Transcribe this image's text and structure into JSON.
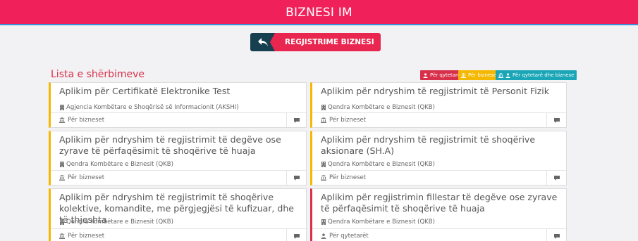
{
  "header": {
    "title": "BIZNESI IM"
  },
  "toolbar": {
    "register_label": "REGJISTRIME BIZNESI"
  },
  "list": {
    "title": "Lista e shërbimeve"
  },
  "legend": [
    {
      "label": "Për qytetarë"
    },
    {
      "label": "Për biznese"
    },
    {
      "label": "Për qytetarë dhe biznese"
    }
  ],
  "colors": {
    "header": "#f0215a",
    "business": "#f5b800",
    "citizen": "#d8304a",
    "both": "#1aa6b7",
    "dark": "#16404f"
  },
  "cards": [
    {
      "title": "Aplikim për Certifikatë Elektronike Test",
      "org": "Agjencia Kombëtare e Shoqërisë së Informacionit (AKSHI)",
      "audience": "Për bizneset"
    },
    {
      "title": "Aplikim për ndryshim të regjistrimit të Personit Fizik",
      "org": "Qendra Kombëtare e Biznesit (QKB)",
      "audience": "Për bizneset"
    },
    {
      "title": "Aplikim për ndryshim të regjistrimit të degëve ose zyrave të përfaqësimit të shoqërive të huaja",
      "org": "Qendra Kombëtare e Biznesit (QKB)",
      "audience": "Për bizneset"
    },
    {
      "title": "Aplikim për ndryshim të regjistrimit të shoqërive aksionare (SH.A)",
      "org": "Qendra Kombëtare e Biznesit (QKB)",
      "audience": "Për bizneset"
    },
    {
      "title": "Aplikim për ndryshim të regjistrimit të shoqërive kolektive, komandite, me përgjegjësi të kufizuar, dhe të thjeshta",
      "org": "Qendra Kombëtare e Biznesit (QKB)",
      "audience": "Për bizneset"
    },
    {
      "title": "Aplikim për regjistrimin fillestar të degëve ose zyrave të përfaqësimit të shoqërive të huaja",
      "org": "Qendra Kombëtare e Biznesit (QKB)",
      "audience": "Për qytetarët"
    }
  ]
}
